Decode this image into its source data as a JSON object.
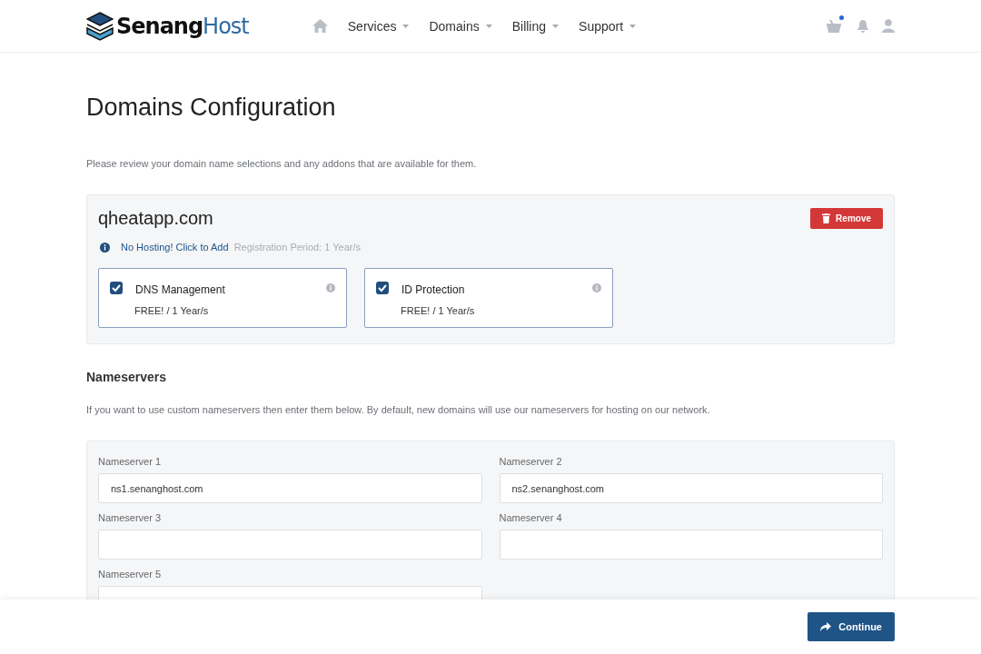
{
  "header": {
    "logo": {
      "primary": "Senang",
      "secondary": "Host"
    },
    "nav": [
      {
        "label": "Services"
      },
      {
        "label": "Domains"
      },
      {
        "label": "Billing"
      },
      {
        "label": "Support"
      }
    ],
    "cart_has_items": true
  },
  "page_title": "Domains Configuration",
  "intro": "Please review your domain name selections and any addons that are available for them.",
  "domain": {
    "name": "qheatapp.com",
    "remove_label": "Remove",
    "hosting_link": "No Hosting! Click to Add",
    "period": "Registration Period: 1 Year/s",
    "addons": [
      {
        "name": "DNS Management",
        "price": "FREE! / 1 Year/s",
        "checked": true
      },
      {
        "name": "ID Protection",
        "price": "FREE! / 1 Year/s",
        "checked": true
      }
    ]
  },
  "nameservers": {
    "title": "Nameservers",
    "description": "If you want to use custom nameservers then enter them below. By default, new domains will use our nameservers for hosting on our network.",
    "fields": [
      {
        "label": "Nameserver 1",
        "value": "ns1.senanghost.com"
      },
      {
        "label": "Nameserver 2",
        "value": "ns2.senanghost.com"
      },
      {
        "label": "Nameserver 3"
      },
      {
        "label": "Nameserver 4"
      },
      {
        "label": "Nameserver 5"
      }
    ]
  },
  "continue_label": "Continue"
}
